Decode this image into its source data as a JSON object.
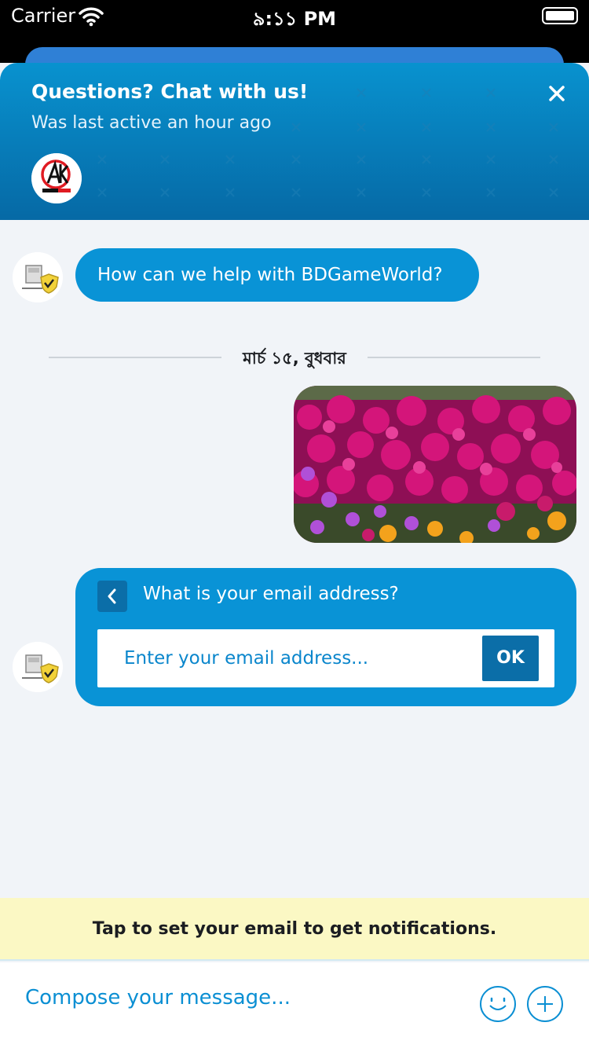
{
  "status_bar": {
    "carrier": "Carrier",
    "time": "৯:১১ PM"
  },
  "header": {
    "title": "Questions? Chat with us!",
    "subtitle": "Was last active an hour ago",
    "avatar_icon": "ak-logo-avatar",
    "brand_color": "#0892cf"
  },
  "messages": {
    "bot_greeting": "How can we help with BDGameWorld?",
    "date_divider": "মার্চ ১৫, বুধবার",
    "image_message": "flower-field-photo"
  },
  "email_form": {
    "question": "What is your email address?",
    "placeholder": "Enter your email address...",
    "submit_label": "OK"
  },
  "notification_bar": {
    "text": "Tap to set your email to get notifications."
  },
  "composer": {
    "placeholder": "Compose your message...",
    "emoji_icon": "emoji-icon",
    "attach_icon": "plus-icon"
  }
}
